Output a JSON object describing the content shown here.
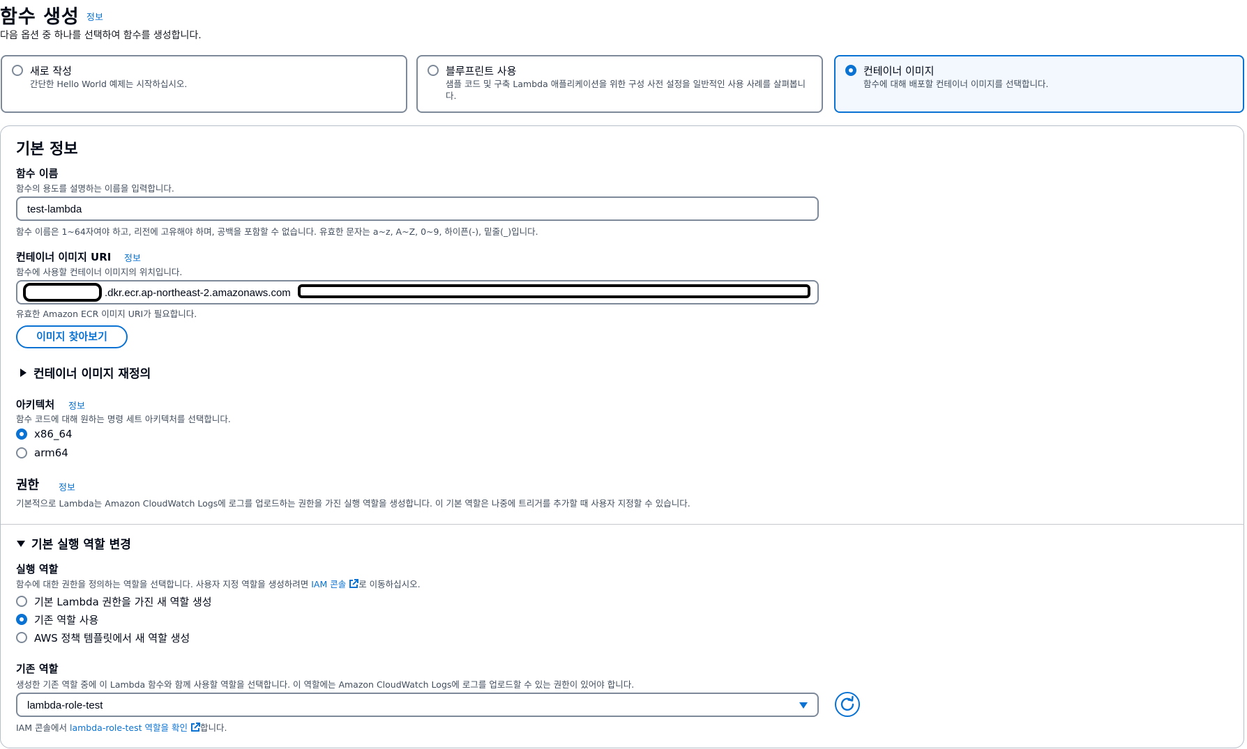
{
  "header": {
    "title": "함수 생성",
    "info": "정보",
    "subtitle": "다음 옵션 중 하나를 선택하여 함수를 생성합니다."
  },
  "options": [
    {
      "title": "새로 작성",
      "desc": "간단한 Hello World 예제는 시작하십시오.",
      "selected": false
    },
    {
      "title": "블루프린트 사용",
      "desc": "샘플 코드 및 구축 Lambda 애플리케이션을 위한 구성 사전 설정을 일반적인 사용 사례를 살펴봅니다.",
      "selected": false
    },
    {
      "title": "컨테이너 이미지",
      "desc": "함수에 대해 배포할 컨테이너 이미지를 선택합니다.",
      "selected": true
    }
  ],
  "basic": {
    "title": "기본 정보",
    "function_name": {
      "label": "함수 이름",
      "desc": "함수의 용도를 설명하는 이름을 입력합니다.",
      "value": "test-lambda",
      "constraint": "함수 이름은 1~64자여야 하고, 리전에 고유해야 하며, 공백을 포함할 수 없습니다. 유효한 문자는 a~z, A~Z, 0~9, 하이픈(-), 밑줄(_)입니다."
    },
    "image_uri": {
      "label": "컨테이너 이미지 URI",
      "info": "정보",
      "desc": "함수에 사용할 컨테이너 이미지의 위치입니다.",
      "value_visible": ".dkr.ecr.ap-northeast-2.amazonaws.com",
      "hint": "유효한 Amazon ECR 이미지 URI가 필요합니다.",
      "browse_button": "이미지 찾아보기"
    },
    "override": {
      "label": "컨테이너 이미지 재정의"
    },
    "architecture": {
      "label": "아키텍처",
      "info": "정보",
      "desc": "함수 코드에 대해 원하는 명령 세트 아키텍처를 선택합니다.",
      "options": [
        {
          "label": "x86_64",
          "selected": true
        },
        {
          "label": "arm64",
          "selected": false
        }
      ]
    },
    "permissions": {
      "title": "권한",
      "info": "정보",
      "desc": "기본적으로 Lambda는 Amazon CloudWatch Logs에 로그를 업로드하는 권한을 가진 실행 역할을 생성합니다. 이 기본 역할은 나중에 트리거를 추가할 때 사용자 지정할 수 있습니다."
    }
  },
  "execution": {
    "toggle": "기본 실행 역할 변경",
    "role_label": "실행 역할",
    "role_desc_pre": "함수에 대한 권한을 정의하는 역할을 선택합니다. 사용자 지정 역할을 생성하려면 ",
    "role_desc_link": "IAM 콘솔",
    "role_desc_post": "로 이동하십시오.",
    "options": [
      {
        "label": "기본 Lambda 권한을 가진 새 역할 생성",
        "selected": false
      },
      {
        "label": "기존 역할 사용",
        "selected": true
      },
      {
        "label": "AWS 정책 템플릿에서 새 역할 생성",
        "selected": false
      }
    ],
    "existing_label": "기존 역할",
    "existing_desc": "생성한 기존 역할 중에 이 Lambda 함수와 함께 사용할 역할을 선택합니다. 이 역할에는 Amazon CloudWatch Logs에 로그를 업로드할 수 있는 권한이 있어야 합니다.",
    "selected_role": "lambda-role-test",
    "footer_pre": "IAM 콘솔에서 ",
    "footer_link": "lambda-role-test 역할을 확인",
    "footer_post": "합니다."
  },
  "colors": {
    "accent": "#0972d3",
    "border": "#7d8998",
    "text": "#000716"
  }
}
